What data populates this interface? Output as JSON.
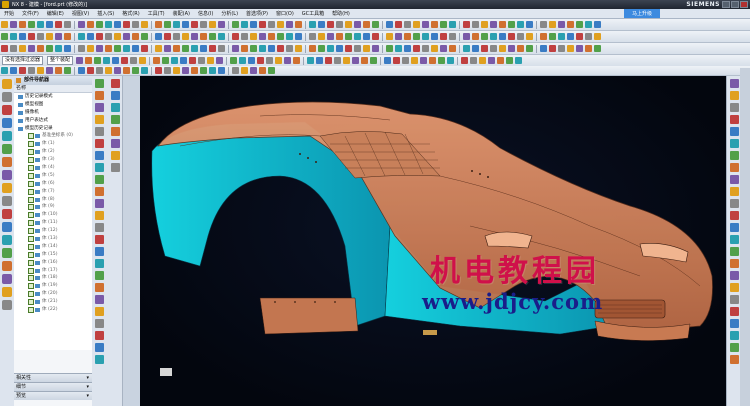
{
  "window": {
    "title": "NX 8 - 建模 - [ford.prt (修改的)]",
    "brand": "SIEMENS"
  },
  "menu": {
    "items": [
      "开始",
      "文件(F)",
      "编辑(E)",
      "视图(V)",
      "插入(S)",
      "格式(R)",
      "工具(T)",
      "装配(A)",
      "信息(I)",
      "分析(L)",
      "首选项(P)",
      "窗口(O)",
      "GC工具箱",
      "帮助(H)"
    ],
    "promo": "马上升级"
  },
  "toolbar": {
    "filter_value": "整个装配",
    "snap_value": "没有选择过滤器"
  },
  "navigator": {
    "title": "部件导航器",
    "column": "名称",
    "items": [
      {
        "label": "历史记录模式",
        "indent": 1
      },
      {
        "label": "模型视图",
        "indent": 1
      },
      {
        "label": "摄像机",
        "indent": 1
      },
      {
        "label": "用户表达式",
        "indent": 1
      },
      {
        "label": "模型历史记录",
        "indent": 1
      },
      {
        "label": "基准坐标系 (0)",
        "indent": 2
      },
      {
        "label": "体 (1)",
        "indent": 2
      },
      {
        "label": "体 (2)",
        "indent": 2
      },
      {
        "label": "体 (3)",
        "indent": 2
      },
      {
        "label": "体 (4)",
        "indent": 2
      },
      {
        "label": "体 (5)",
        "indent": 2
      },
      {
        "label": "体 (6)",
        "indent": 2
      },
      {
        "label": "体 (7)",
        "indent": 2
      },
      {
        "label": "体 (8)",
        "indent": 2
      },
      {
        "label": "体 (9)",
        "indent": 2
      },
      {
        "label": "体 (10)",
        "indent": 2
      },
      {
        "label": "体 (11)",
        "indent": 2
      },
      {
        "label": "体 (12)",
        "indent": 2
      },
      {
        "label": "体 (13)",
        "indent": 2
      },
      {
        "label": "体 (14)",
        "indent": 2
      },
      {
        "label": "体 (15)",
        "indent": 2
      },
      {
        "label": "体 (16)",
        "indent": 2
      },
      {
        "label": "体 (17)",
        "indent": 2
      },
      {
        "label": "体 (18)",
        "indent": 2
      },
      {
        "label": "体 (19)",
        "indent": 2
      },
      {
        "label": "体 (20)",
        "indent": 2
      },
      {
        "label": "体 (21)",
        "indent": 2
      },
      {
        "label": "体 (22)",
        "indent": 2
      }
    ],
    "sections": [
      "相关性",
      "细节",
      "预览"
    ]
  },
  "watermark": {
    "title": "机电教程园",
    "url": "www.jdjcy.com"
  },
  "colors": {
    "body_orange": "#d9845a",
    "body_cyan": "#1fb7c8",
    "background": "#050a18",
    "accent": "#d0104a"
  }
}
